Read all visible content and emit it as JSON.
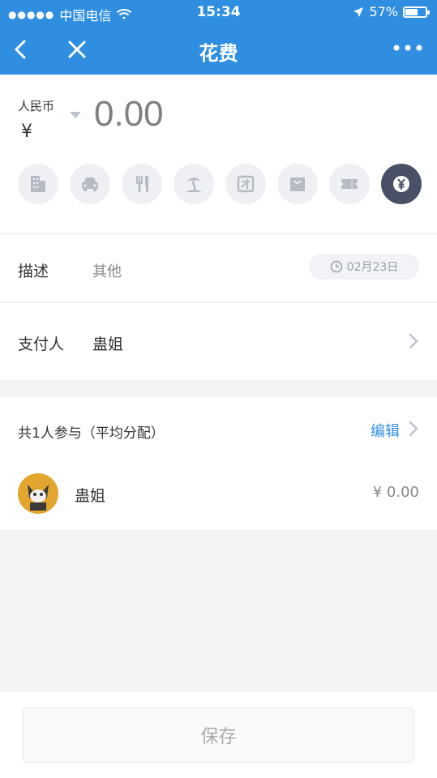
{
  "status": {
    "carrier": "中国电信",
    "time": "15:34",
    "battery": "57%",
    "battery_level": 0.57
  },
  "nav": {
    "title": "花费"
  },
  "amount": {
    "currency_name": "人民币",
    "currency_symbol": "¥",
    "value": "0.00"
  },
  "categories": [
    {
      "icon": "building-icon"
    },
    {
      "icon": "car-icon"
    },
    {
      "icon": "fork-knife-icon"
    },
    {
      "icon": "beach-icon"
    },
    {
      "icon": "group-buy-icon"
    },
    {
      "icon": "shopping-bag-icon"
    },
    {
      "icon": "ticket-icon"
    },
    {
      "icon": "yuan-coin-icon",
      "active": true
    }
  ],
  "description": {
    "label": "描述",
    "value": "其他",
    "date": "02月23日"
  },
  "payer": {
    "label": "支付人",
    "value": "蛊姐"
  },
  "participants": {
    "title": "共1人参与（平均分配）",
    "edit_label": "编辑",
    "members": [
      {
        "name": "蛊姐",
        "amount": "¥ 0.00"
      }
    ]
  },
  "footer": {
    "save_label": "保存"
  },
  "colors": {
    "primary": "#2f8ee0",
    "active_category": "#4a5066"
  }
}
